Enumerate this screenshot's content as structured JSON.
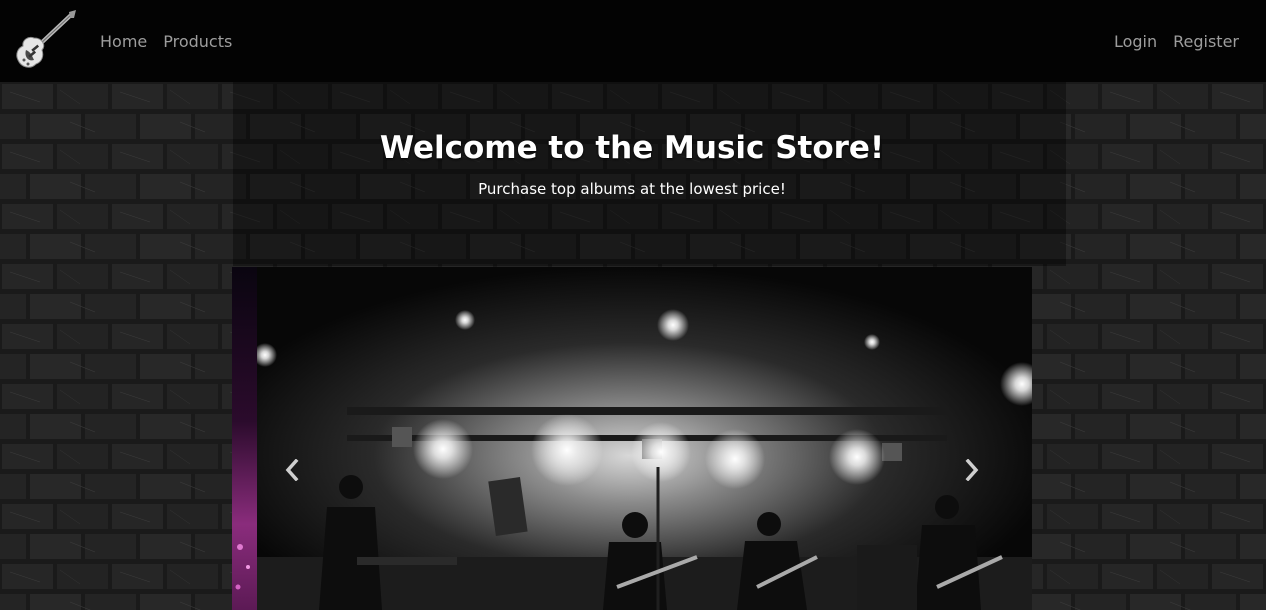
{
  "navbar": {
    "brand_icon": "guitar-icon",
    "left_links": [
      {
        "label": "Home"
      },
      {
        "label": "Products"
      }
    ],
    "right_links": [
      {
        "label": "Login"
      },
      {
        "label": "Register"
      }
    ]
  },
  "hero": {
    "title": "Welcome to the Music Store!",
    "subtitle": "Purchase top albums at the lowest price!",
    "background": "brick-wall"
  },
  "carousel": {
    "active_slide": "concert-stage-photo",
    "prev_icon": "chevron-left-icon",
    "next_icon": "chevron-right-icon"
  },
  "colors": {
    "navbar_bg": "#030303",
    "nav_link": "#9d9d9d",
    "hero_text": "#ffffff"
  }
}
